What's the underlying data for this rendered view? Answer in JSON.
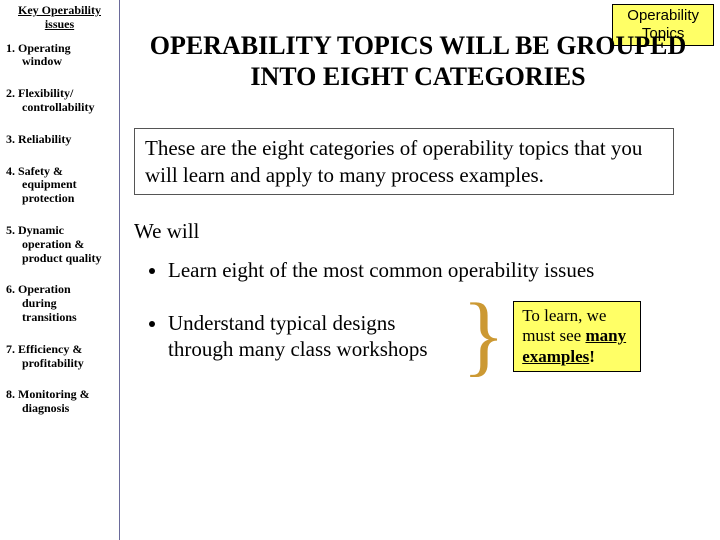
{
  "badge": {
    "line1": "Operability",
    "line2": "Topics"
  },
  "sidebar": {
    "title_l1": "Key Operability",
    "title_l2": "issues",
    "items": [
      {
        "num": "1.",
        "first": "Operating",
        "cont": "window"
      },
      {
        "num": "2.",
        "first": "Flexibility/",
        "cont": "controllability"
      },
      {
        "num": "3.",
        "first": "Reliability",
        "cont": ""
      },
      {
        "num": "4.",
        "first": "Safety &",
        "cont": "equipment protection"
      },
      {
        "num": "5.",
        "first": "Dynamic",
        "cont": "operation & product quality"
      },
      {
        "num": "6.",
        "first": "Operation",
        "cont": "during transitions"
      },
      {
        "num": "7.",
        "first": "Efficiency &",
        "cont": "profitability"
      },
      {
        "num": "8.",
        "first": "Monitoring &",
        "cont": "diagnosis"
      }
    ]
  },
  "main": {
    "title": "OPERABILITY TOPICS WILL BE GROUPED INTO EIGHT CATEGORIES",
    "intro": "These are the eight categories of operability topics that you will learn and apply to many process examples.",
    "lead": "We will",
    "bullet1": "Learn eight of the most common operability issues",
    "bullet2": "Understand typical designs through many class workshops",
    "callout_pre": "To learn, we must see ",
    "callout_key": "many examples",
    "callout_post": "!"
  }
}
